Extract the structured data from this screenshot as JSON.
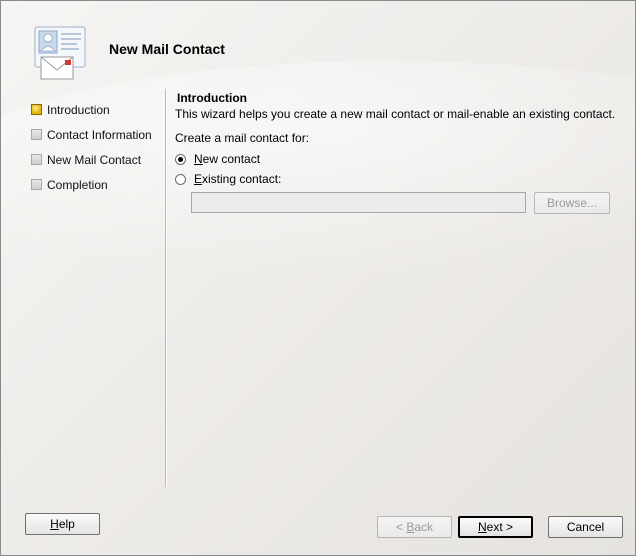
{
  "window": {
    "title": "New Mail Contact"
  },
  "steps": [
    {
      "label": "Introduction",
      "active": true
    },
    {
      "label": "Contact Information",
      "active": false
    },
    {
      "label": "New Mail Contact",
      "active": false
    },
    {
      "label": "Completion",
      "active": false
    }
  ],
  "introduction": {
    "title": "Introduction",
    "description": "This wizard helps you create a new mail contact or mail-enable an existing contact.",
    "create_label": "Create a mail contact for:",
    "option_new_prefix": "",
    "option_new_key": "N",
    "option_new_rest": "ew contact",
    "option_existing_key": "E",
    "option_existing_rest": "xisting contact:",
    "existing_value": "",
    "browse_label": "Browse..."
  },
  "footer": {
    "help_key": "H",
    "help_rest": "elp",
    "back_arrow": "< ",
    "back_key": "B",
    "back_rest": "ack",
    "next_key": "N",
    "next_rest": "ext >",
    "cancel_label": "Cancel"
  },
  "colors": {
    "active_step": "#e0b400",
    "background": "#eeece9"
  }
}
